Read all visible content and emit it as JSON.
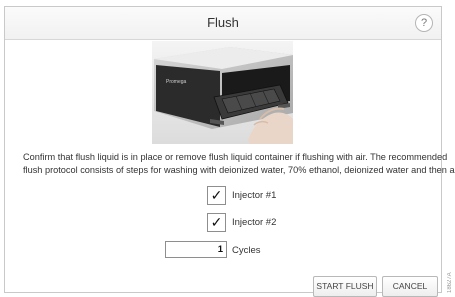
{
  "dialog": {
    "title": "Flush",
    "help_label": "?"
  },
  "photo": {
    "brand_text": "Promega"
  },
  "description": {
    "line1": "Confirm that flush liquid is in place or remove flush liquid container if flushing with air. The recommended",
    "line2": "flush protocol consists of steps for washing with deionized water, 70% ethanol, deionized water and then air."
  },
  "injectors": [
    {
      "label": "Injector #1",
      "checked": true,
      "mark": "✓"
    },
    {
      "label": "Injector #2",
      "checked": true,
      "mark": "✓"
    }
  ],
  "cycles": {
    "value": "1",
    "label": "Cycles"
  },
  "buttons": {
    "start_flush": "START FLUSH",
    "cancel": "CANCEL"
  },
  "side_tag": "18627A"
}
